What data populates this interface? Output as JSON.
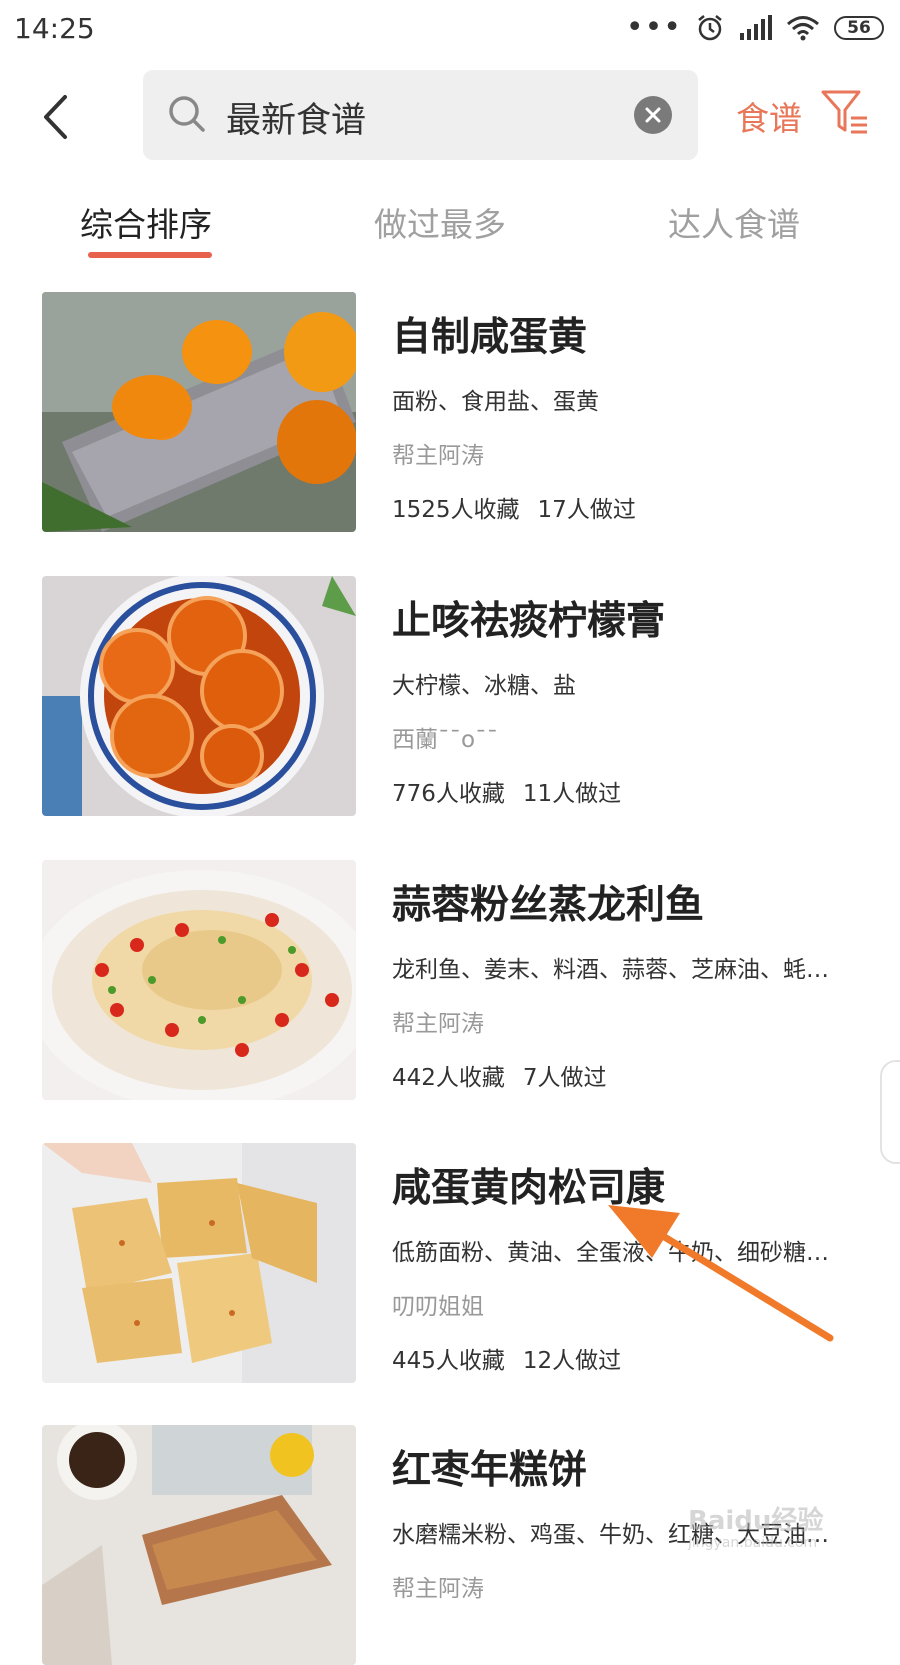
{
  "status_bar": {
    "time": "14:25",
    "battery": "56",
    "icons": [
      "more-dots-icon",
      "alarm-icon",
      "signal-icon",
      "wifi-icon",
      "battery-icon"
    ]
  },
  "header": {
    "back_icon": "chevron-left-icon",
    "search": {
      "value": "最新食谱",
      "icon": "search-icon",
      "clear_icon": "clear-icon"
    },
    "category_label": "食谱",
    "filter_icon": "filter-icon"
  },
  "tabs": [
    {
      "label": "综合排序",
      "active": true
    },
    {
      "label": "做过最多",
      "active": false
    },
    {
      "label": "达人食谱",
      "active": false
    }
  ],
  "recipes": [
    {
      "title": "自制咸蛋黄",
      "ingredients": "面粉、食用盐、蛋黄",
      "author": "帮主阿涛",
      "favorites": "1525人收藏",
      "made": "17人做过"
    },
    {
      "title": "止咳祛痰柠檬膏",
      "ingredients": "大柠檬、冰糖、盐",
      "author": "西蘭¯¯o¯¯",
      "favorites": "776人收藏",
      "made": "11人做过"
    },
    {
      "title": "蒜蓉粉丝蒸龙利鱼",
      "ingredients": "龙利鱼、姜末、料酒、蒜蓉、芝麻油、蚝…",
      "author": "帮主阿涛",
      "favorites": "442人收藏",
      "made": "7人做过"
    },
    {
      "title": "咸蛋黄肉松司康",
      "ingredients": "低筋面粉、黄油、全蛋液、牛奶、细砂糖…",
      "author": "叨叨姐姐",
      "favorites": "445人收藏",
      "made": "12人做过"
    },
    {
      "title": "红枣年糕饼",
      "ingredients": "水磨糯米粉、鸡蛋、牛奶、红糖、大豆油…",
      "author": "帮主阿涛",
      "favorites": "",
      "made": ""
    }
  ],
  "watermark": {
    "brand": "Baidu经验",
    "url": "jingyan.baidu.com"
  },
  "colors": {
    "accent": "#e8775a",
    "tab_underline": "#e8614d",
    "arrow": "#f07a2a"
  }
}
